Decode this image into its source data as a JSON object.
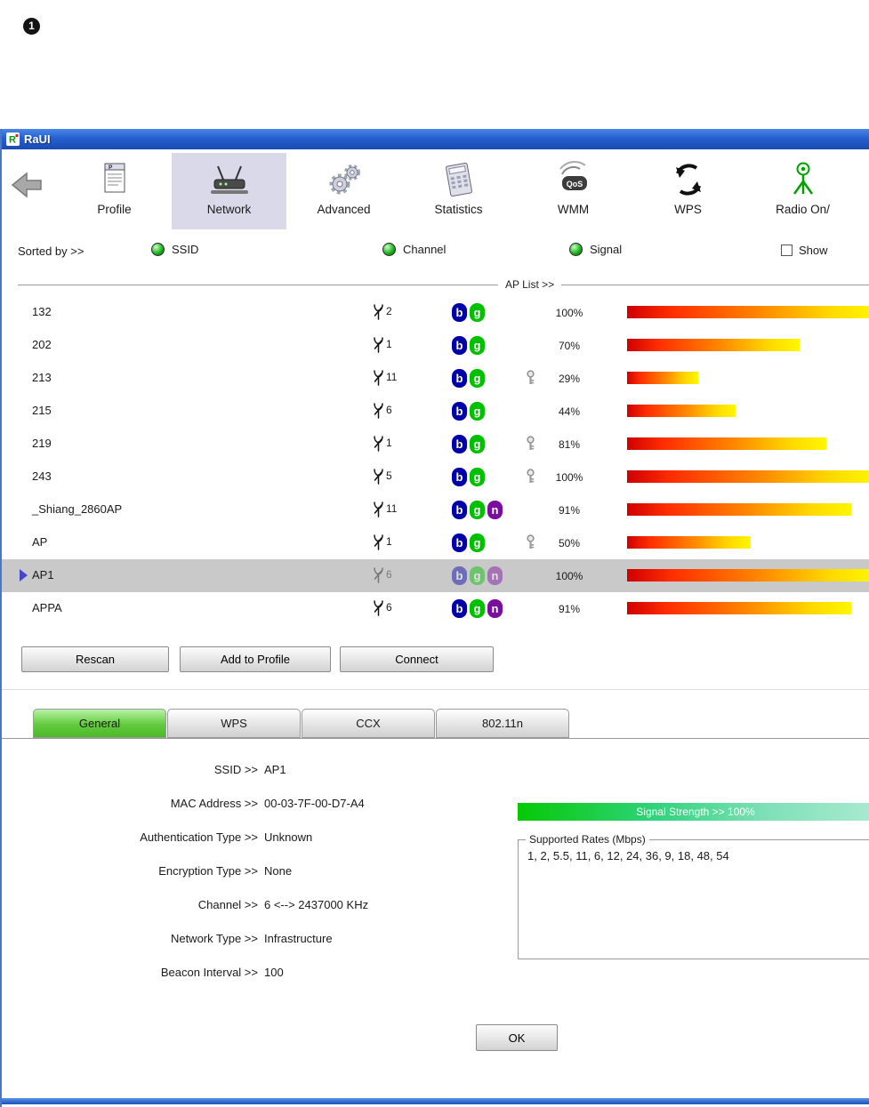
{
  "annotation": {
    "number": "1"
  },
  "colors": {
    "titlebar_blue": "#2560d0",
    "toolbar_selected_bg": "#d9d9ea",
    "badge_b": "#0000a8",
    "badge_g": "#00c000",
    "badge_n": "#7a0d9e",
    "signal_bar_gradient": [
      "#cf0000",
      "#ff8a00",
      "#fff600"
    ],
    "strength_bar_green": "#06c906",
    "selected_tab_green": "#62ca3c",
    "selected_row_gray": "#c9c9c9",
    "row_arrow_blue": "#4646c8",
    "led_green": "#1fb41f"
  },
  "window": {
    "title": "RaUI",
    "toolbar": [
      {
        "name": "profile",
        "label": "Profile",
        "selected": false
      },
      {
        "name": "network",
        "label": "Network",
        "selected": true
      },
      {
        "name": "advanced",
        "label": "Advanced",
        "selected": false
      },
      {
        "name": "statistics",
        "label": "Statistics",
        "selected": false
      },
      {
        "name": "wmm",
        "label": "WMM",
        "selected": false
      },
      {
        "name": "wps",
        "label": "WPS",
        "selected": false
      },
      {
        "name": "radio",
        "label": "Radio On/",
        "selected": false
      }
    ],
    "sort_bar": {
      "label": "Sorted by >>",
      "options": [
        "SSID",
        "Channel",
        "Signal"
      ],
      "show_checkbox_label": "Show"
    },
    "ap_list": {
      "header": "AP List >>",
      "rows": [
        {
          "ssid": "132",
          "channel": "2",
          "modes": [
            "b",
            "g"
          ],
          "secured": false,
          "signal": "100%",
          "signal_pct": 100,
          "selected": false
        },
        {
          "ssid": "202",
          "channel": "1",
          "modes": [
            "b",
            "g"
          ],
          "secured": false,
          "signal": "70%",
          "signal_pct": 70,
          "selected": false
        },
        {
          "ssid": "213",
          "channel": "11",
          "modes": [
            "b",
            "g"
          ],
          "secured": true,
          "signal": "29%",
          "signal_pct": 29,
          "selected": false
        },
        {
          "ssid": "215",
          "channel": "6",
          "modes": [
            "b",
            "g"
          ],
          "secured": false,
          "signal": "44%",
          "signal_pct": 44,
          "selected": false
        },
        {
          "ssid": "219",
          "channel": "1",
          "modes": [
            "b",
            "g"
          ],
          "secured": true,
          "signal": "81%",
          "signal_pct": 81,
          "selected": false
        },
        {
          "ssid": "243",
          "channel": "5",
          "modes": [
            "b",
            "g"
          ],
          "secured": true,
          "signal": "100%",
          "signal_pct": 100,
          "selected": false
        },
        {
          "ssid": "_Shiang_2860AP",
          "channel": "11",
          "modes": [
            "b",
            "g",
            "n"
          ],
          "secured": false,
          "signal": "91%",
          "signal_pct": 91,
          "selected": false
        },
        {
          "ssid": "AP",
          "channel": "1",
          "modes": [
            "b",
            "g"
          ],
          "secured": true,
          "signal": "50%",
          "signal_pct": 50,
          "selected": false
        },
        {
          "ssid": "AP1",
          "channel": "6",
          "modes": [
            "b",
            "g",
            "n"
          ],
          "secured": false,
          "signal": "100%",
          "signal_pct": 100,
          "selected": true
        },
        {
          "ssid": "APPA",
          "channel": "6",
          "modes": [
            "b",
            "g",
            "n"
          ],
          "secured": false,
          "signal": "91%",
          "signal_pct": 91,
          "selected": false
        }
      ]
    },
    "buttons": [
      "Rescan",
      "Add to Profile",
      "Connect"
    ],
    "tabs": [
      {
        "label": "General",
        "selected": true
      },
      {
        "label": "WPS",
        "selected": false
      },
      {
        "label": "CCX",
        "selected": false
      },
      {
        "label": "802.11n",
        "selected": false
      }
    ],
    "details": [
      {
        "label": "SSID >>",
        "value": "AP1"
      },
      {
        "label": "MAC Address >>",
        "value": "00-03-7F-00-D7-A4"
      },
      {
        "label": "Authentication Type >>",
        "value": "Unknown"
      },
      {
        "label": "Encryption Type >>",
        "value": "None"
      },
      {
        "label": "Channel >>",
        "value": "6 <--> 2437000 KHz"
      },
      {
        "label": "Network Type >>",
        "value": "Infrastructure"
      },
      {
        "label": "Beacon Interval >>",
        "value": "100"
      }
    ],
    "signal_strength": {
      "label": "Signal Strength >> 100%"
    },
    "supported_rates": {
      "title": "Supported Rates (Mbps)",
      "value": "1, 2, 5.5, 11, 6, 12, 24, 36, 9, 18, 48, 54"
    },
    "ok_button": "OK"
  }
}
